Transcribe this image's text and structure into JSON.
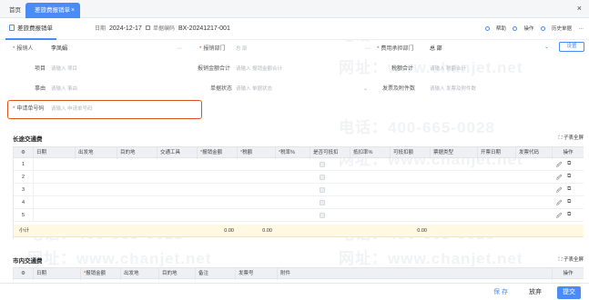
{
  "tabs": {
    "home": "首页",
    "active": "差旅费报销单",
    "close": "×"
  },
  "window": {
    "close": "×"
  },
  "toolbar": {
    "title": "差旅费报销单",
    "date_label": "日期",
    "date_value": "2024-12-17",
    "code_label": "单据编码",
    "code_value": "BX-20241217-001",
    "help": "帮助",
    "operate": "操作",
    "history": "历史单据",
    "settings": "设置"
  },
  "form": {
    "reimburser_label": "报销人",
    "reimburser_value": "李凤娟",
    "dept_label": "报销部门",
    "dept_value": "总 部",
    "cost_dept_label": "费用承担部门",
    "cost_dept_value": "总 部",
    "project_label": "项目",
    "project_placeholder": "请输入 项目",
    "amount_total_label": "报销金额合计",
    "amount_total_placeholder": "请输入 报销金额合计",
    "tax_total_label": "税额合计",
    "tax_total_placeholder": "请输入 税额合计",
    "reason_label": "事由",
    "reason_placeholder": "请输入 事由",
    "status_label": "单据状态",
    "status_placeholder": "请输入 单据状态",
    "attachments_label": "发票及附件数",
    "attachments_placeholder": "请输入 发票及附件数",
    "apply_no_label": "申请单号码",
    "apply_no_placeholder": "请输入 申请单号码"
  },
  "long_trip": {
    "title": "长途交通费",
    "sub_fullscreen": "子表全屏",
    "columns": [
      "日期",
      "出发地",
      "目的地",
      "交通工具",
      "报销金额",
      "税额",
      "税率%",
      "是否可抵扣",
      "抵扣率%",
      "可抵扣额",
      "票据类型",
      "开票日期",
      "发票代码",
      "操作"
    ],
    "row_numbers": [
      "1",
      "2",
      "3",
      "4",
      "5"
    ],
    "total_label": "小计",
    "total_amount": "0.00",
    "total_tax": "0.00",
    "total_deductible": "0.00"
  },
  "city_trip": {
    "title": "市内交通费",
    "sub_fullscreen": "子表全屏",
    "columns": [
      "日期",
      "报销金额",
      "出发地",
      "目的地",
      "备注",
      "发票号",
      "附件",
      "操作"
    ]
  },
  "footer": {
    "save": "保 存",
    "cancel": "放弃",
    "submit": "提交"
  },
  "watermarks": {
    "phone": "电话：400-665-0028",
    "site": "网址：www.chanjet.net"
  }
}
